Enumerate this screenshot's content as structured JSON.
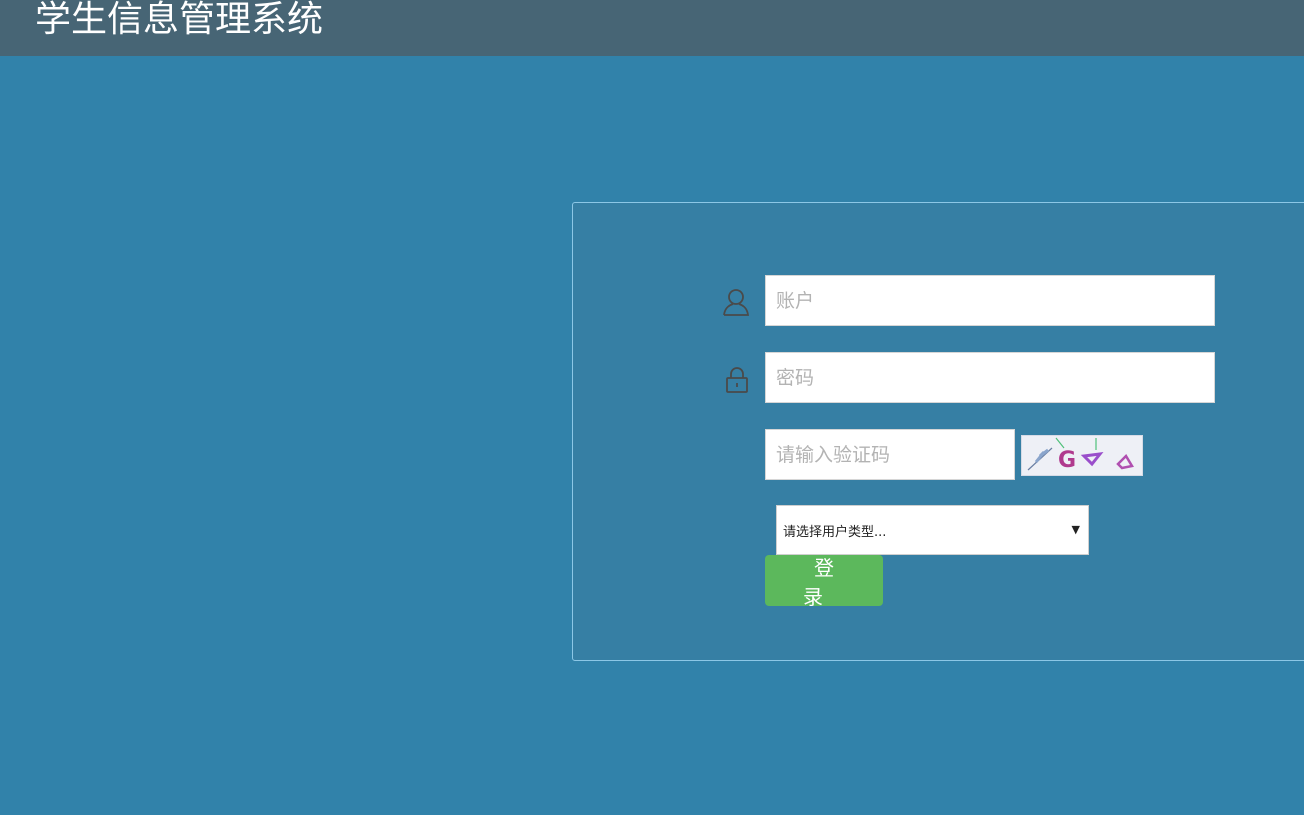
{
  "header": {
    "title": "学生信息管理系统"
  },
  "login": {
    "account_placeholder": "账户",
    "password_placeholder": "密码",
    "captcha_placeholder": "请输入验证码",
    "user_type_selected": "请选择用户类型...",
    "login_label": "登 录"
  },
  "icons": {
    "account": "user-icon",
    "password": "lock-icon",
    "select": "dropdown-arrow-icon"
  },
  "colors": {
    "background": "#3182aa",
    "header": "#476575",
    "panel": "#367fa4",
    "login_button": "#5cb85c"
  }
}
